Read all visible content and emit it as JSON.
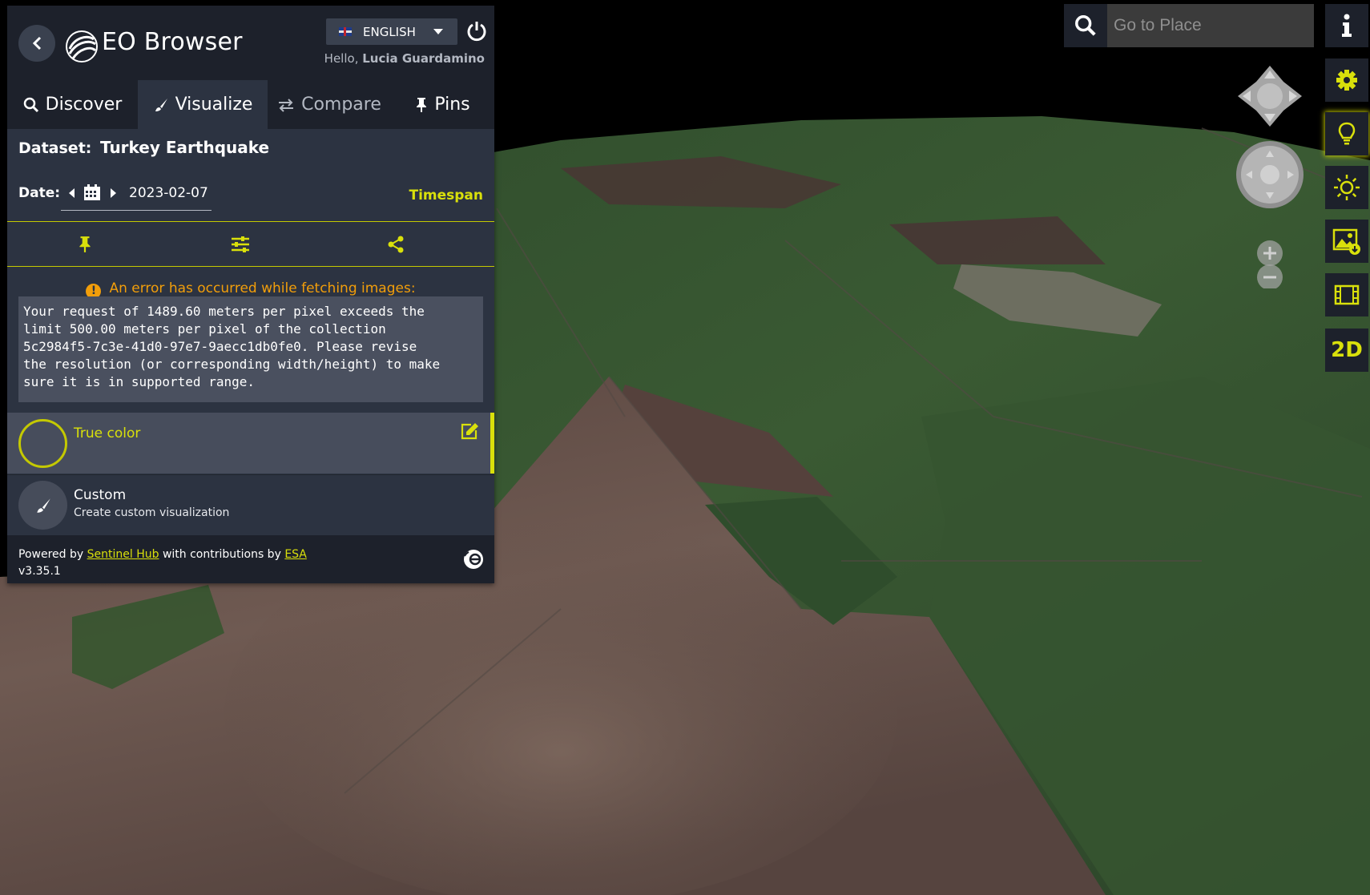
{
  "header": {
    "app_title": "EO Browser",
    "language": "ENGLISH",
    "greeting_prefix": "Hello,",
    "user_name": "Lucia Guardamino"
  },
  "tabs": [
    {
      "label": "Discover",
      "icon": "search-icon",
      "active": false
    },
    {
      "label": "Visualize",
      "icon": "brush-icon",
      "active": true
    },
    {
      "label": "Compare",
      "icon": "compare-arrows-icon",
      "active": false
    },
    {
      "label": "Pins",
      "icon": "pin-icon",
      "active": false
    }
  ],
  "dataset": {
    "label": "Dataset:",
    "value": "Turkey Earthquake"
  },
  "date": {
    "label": "Date:",
    "value": "2023-02-07",
    "timespan_label": "Timespan"
  },
  "error": {
    "title": "An error has occurred while fetching images:",
    "message": "Your request of 1489.60 meters per pixel exceeds the\nlimit 500.00 meters per pixel of the collection\n5c2984f5-7c3e-41d0-97e7-9aecc1db0fe0. Please revise\nthe resolution (or corresponding width/height) to make\nsure it is in supported range."
  },
  "layers": [
    {
      "name": "True color",
      "selected": true
    },
    {
      "name": "Custom",
      "description": "Create custom visualization",
      "selected": false
    }
  ],
  "footer": {
    "powered_by": "Powered by",
    "sentinel_hub": "Sentinel Hub",
    "contributions": "with contributions by",
    "esa": "ESA",
    "version": "v3.35.1"
  },
  "search": {
    "placeholder": "Go to Place"
  },
  "toolbar": {
    "items": [
      "info-icon",
      "settings-icon",
      "lightbulb-icon",
      "sun-icon",
      "image-download-icon",
      "film-icon"
    ],
    "mode_label": "2D"
  },
  "colors": {
    "accent": "#d9e00b",
    "panel": "#2c3341",
    "header": "#1d212b",
    "warning": "#f29e0a"
  }
}
